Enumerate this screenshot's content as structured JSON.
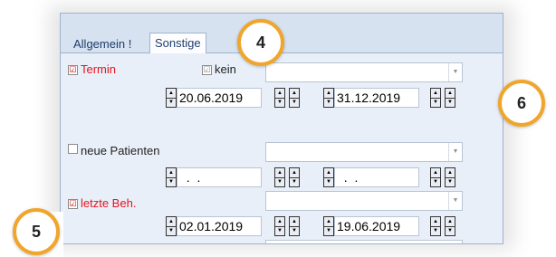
{
  "tabs": {
    "allgemein": "Allgemein !",
    "sonstige": "Sonstige"
  },
  "termin": {
    "label": "Termin",
    "checked": "☑",
    "kein_label": "kein",
    "kein_checked": "☑",
    "date_from": "20.06.2019",
    "date_to": "31.12.2019"
  },
  "neue_patienten": {
    "label": "neue Patienten",
    "checked": "",
    "date_from": "  .  .",
    "date_to": "  .  ."
  },
  "letzte_beh": {
    "label": "letzte Beh.",
    "checked": "☑",
    "date_from": "02.01.2019",
    "date_to": "19.06.2019"
  },
  "callouts": {
    "four": "4",
    "five": "5",
    "six": "6"
  },
  "colors": {
    "accent": "#f0a52b",
    "red_label": "#e8111e",
    "tab_text": "#1f3d6b"
  },
  "icons": {
    "spin_up": "▲",
    "spin_down": "▼",
    "dropdown": "▼"
  }
}
